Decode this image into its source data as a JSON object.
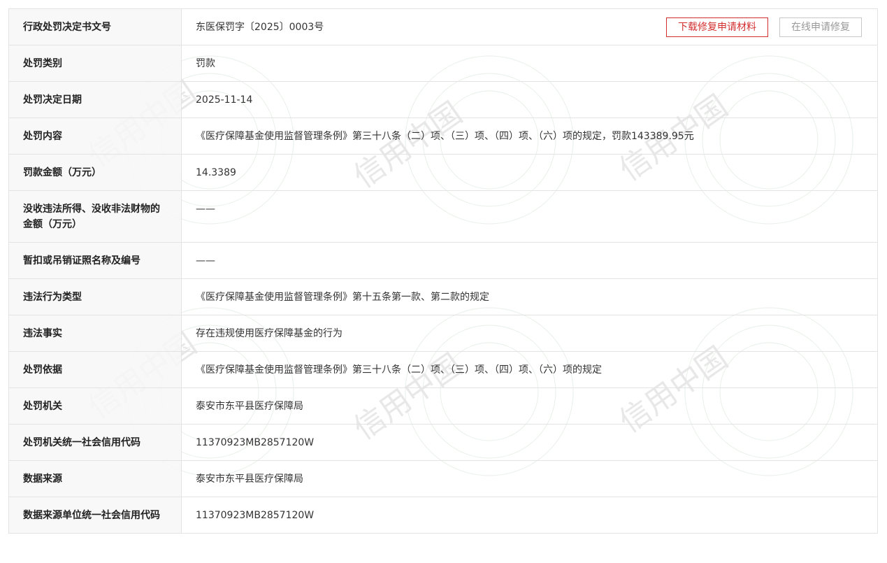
{
  "watermark": {
    "text": "信用中国"
  },
  "actions": {
    "download_label": "下载修复申请材料",
    "apply_label": "在线申请修复"
  },
  "rows": [
    {
      "label": "行政处罚决定书文号",
      "value": "东医保罚字〔2025〕0003号"
    },
    {
      "label": "处罚类别",
      "value": "罚款"
    },
    {
      "label": "处罚决定日期",
      "value": "2025-11-14"
    },
    {
      "label": "处罚内容",
      "value": "《医疗保障基金使用监督管理条例》第三十八条（二）项、（三）项、（四）项、（六）项的规定，罚款143389.95元"
    },
    {
      "label": "罚款金额（万元）",
      "value": "14.3389"
    },
    {
      "label": "没收违法所得、没收非法财物的金额（万元）",
      "value": "——"
    },
    {
      "label": "暂扣或吊销证照名称及编号",
      "value": "——"
    },
    {
      "label": "违法行为类型",
      "value": "《医疗保障基金使用监督管理条例》第十五条第一款、第二款的规定"
    },
    {
      "label": "违法事实",
      "value": "存在违规使用医疗保障基金的行为"
    },
    {
      "label": "处罚依据",
      "value": "《医疗保障基金使用监督管理条例》第三十八条（二）项、（三）项、（四）项、（六）项的规定"
    },
    {
      "label": "处罚机关",
      "value": "泰安市东平县医疗保障局"
    },
    {
      "label": "处罚机关统一社会信用代码",
      "value": "11370923MB2857120W"
    },
    {
      "label": "数据来源",
      "value": "泰安市东平县医疗保障局"
    },
    {
      "label": "数据来源单位统一社会信用代码",
      "value": "11370923MB2857120W"
    }
  ]
}
